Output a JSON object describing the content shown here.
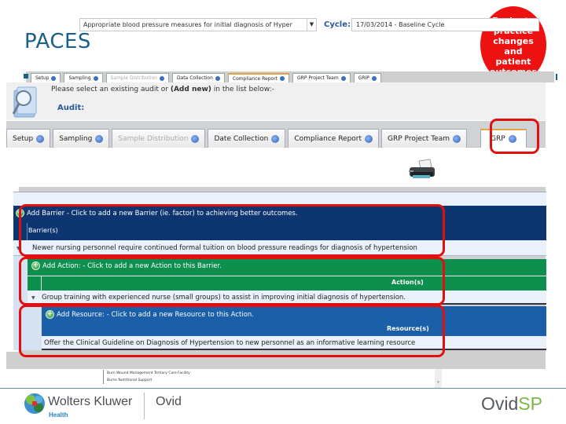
{
  "slide": {
    "title": "PACES",
    "callout": "Evaluate practice changes and patient outcomes"
  },
  "small_tabs": [
    {
      "label": "Setup",
      "state": "normal"
    },
    {
      "label": "Sampling",
      "state": "normal"
    },
    {
      "label": "Sample Distribution",
      "state": "disabled"
    },
    {
      "label": "Data Collection",
      "state": "normal"
    },
    {
      "label": "Compliance Report",
      "state": "active"
    },
    {
      "label": "GRP Project Team",
      "state": "normal"
    },
    {
      "label": "GRIP",
      "state": "normal"
    }
  ],
  "audit_panel": {
    "prompt_prefix": "Please select an existing audit or ",
    "prompt_bold": "(Add new)",
    "prompt_suffix": " in the list below:-",
    "audit_label": "Audit:",
    "audit_value": "Appropriate blood pressure measures for initial diagnosis of Hyper",
    "cycle_label": "Cycle:",
    "cycle_value": "17/03/2014 - Baseline Cycle"
  },
  "main_tabs": [
    {
      "label": "Setup",
      "state": "normal"
    },
    {
      "label": "Sampling",
      "state": "normal"
    },
    {
      "label": "Sample Distribution",
      "state": "disabled"
    },
    {
      "label": "Date Collection",
      "state": "normal"
    },
    {
      "label": "Compliance Report",
      "state": "normal"
    },
    {
      "label": "GRP Project Team",
      "state": "normal"
    },
    {
      "label": "GRP",
      "state": "active"
    }
  ],
  "grid": {
    "barrier": {
      "add_label": "Add Barrier - Click to add a new Barrier (ie. factor) to achieving better outcomes.",
      "column": "Barrier(s)",
      "row": "Newer nursing personnel require continued formal tuition on blood pressure readings for diagnosis of hypertension"
    },
    "action": {
      "add_label": "Add Action: - Click to add a new Action to this Barrier.",
      "column": "Action(s)",
      "row": "Group training with experienced nurse (small groups) to assist in improving initial diagnosis of hypertension."
    },
    "resource": {
      "add_label": "Add Resource: - Click to add a new Resource to this Action.",
      "column": "Resource(s)",
      "row": "Offer the Clinical Guideline on Diagnosis of Hypertension to new personnel as an informative learning resource"
    }
  },
  "bottom_list": [
    "Burn Wound Management Tertiary Care Facility",
    "Burns Nutritional Support"
  ],
  "footer": {
    "brand": "Wolters Kluwer",
    "brand_sub": "Health",
    "product": "Ovid",
    "logo_main": "Ovid",
    "logo_accent": "SP"
  },
  "colors": {
    "highlight": "#e01010",
    "barrier_header": "#0d3670",
    "action_header": "#0f8f4d",
    "resource_header": "#1a5fa8",
    "title": "#1a5f8c",
    "callout": "#ee1111"
  }
}
